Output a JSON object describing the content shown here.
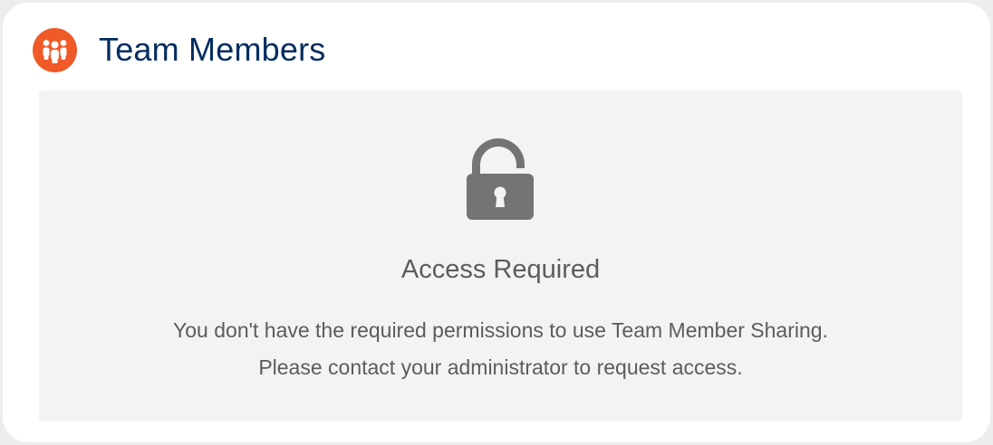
{
  "card": {
    "title": "Team Members",
    "icon": "team-members-icon"
  },
  "access": {
    "icon": "lock-icon",
    "title": "Access Required",
    "message_line1": "You don't have the required permissions to use Team Member Sharing.",
    "message_line2": "Please contact your administrator to request access."
  },
  "colors": {
    "icon_background": "#f05a28",
    "title_color": "#032d60",
    "panel_background": "#f3f3f3",
    "lock_color": "#747474",
    "text_color": "#5c5c5c"
  }
}
